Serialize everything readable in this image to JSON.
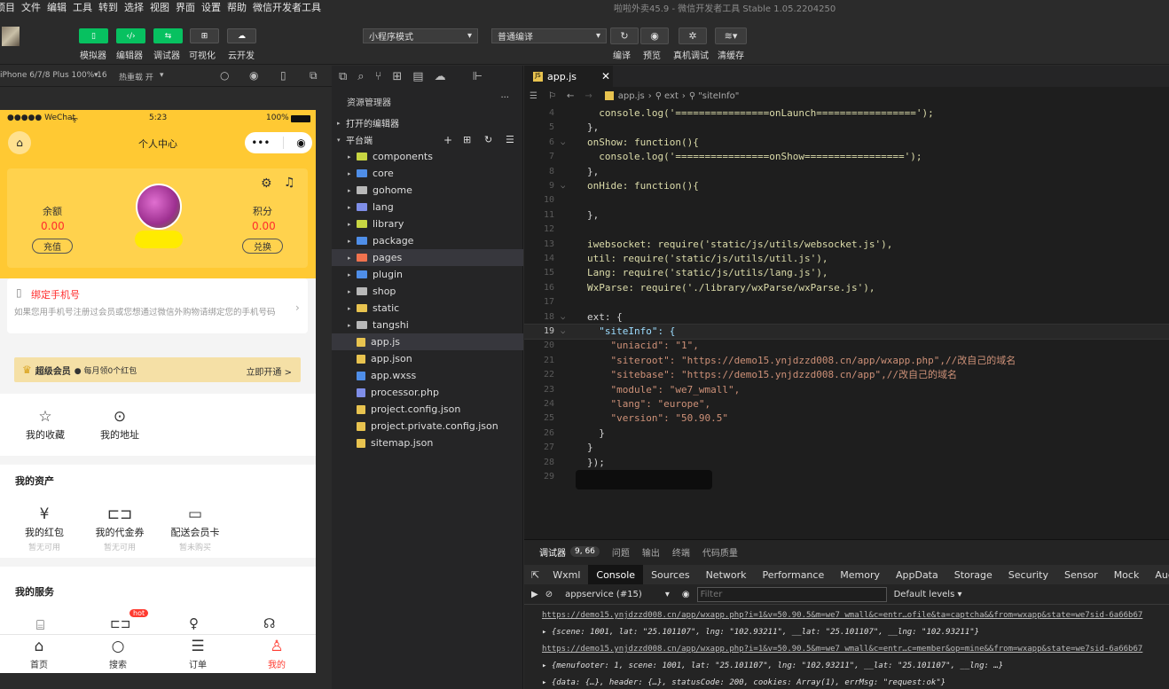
{
  "menu": [
    "项目",
    "文件",
    "编辑",
    "工具",
    "转到",
    "选择",
    "视图",
    "界面",
    "设置",
    "帮助",
    "微信开发者工具"
  ],
  "window_title": "啦啦外卖45.9 - 微信开发者工具 Stable 1.05.2204250",
  "toolbar": {
    "simulator": "模拟器",
    "editor": "编辑器",
    "debugger": "调试器",
    "visual": "可视化",
    "cloud": "云开发",
    "mode_select": "小程序模式",
    "compile_select": "普通编译",
    "compile": "编译",
    "preview": "预览",
    "real_debug": "真机调试",
    "clear_cache": "清缓存"
  },
  "simbar": {
    "device": "iPhone 6/7/8 Plus 100% 16",
    "hotreload": "热重载 开"
  },
  "phone": {
    "carrier": "●●●●● WeChat",
    "time": "5:23",
    "battery": "100%",
    "nav_title": "个人中心",
    "balance_label": "余额",
    "balance_value": "0.00",
    "recharge": "充值",
    "points_label": "积分",
    "points_value": "0.00",
    "exchange": "兑换",
    "bind_title": "绑定手机号",
    "bind_desc": "如果您用手机号注册过会员或您想通过微信外购物请绑定您的手机号码",
    "vip_title": "超级会员",
    "vip_desc": "● 每月领0个红包",
    "vip_action": "立即开通 >",
    "fav": "我的收藏",
    "address": "我的地址",
    "assets_title": "我的资产",
    "redpacket": "我的红包",
    "redpacket_sub": "暂无可用",
    "voucher": "我的代金券",
    "voucher_sub": "暂无可用",
    "delivery_card": "配送会员卡",
    "delivery_card_sub": "暂未购买",
    "services_title": "我的服务",
    "hot": "hot",
    "tabs": [
      "首页",
      "搜索",
      "订单",
      "我的"
    ]
  },
  "explorer": {
    "header": "资源管理器",
    "open_editors": "打开的编辑器",
    "workspace": "平台端",
    "items": [
      {
        "name": "components",
        "type": "folder",
        "color": "#c8d642"
      },
      {
        "name": "core",
        "type": "folder",
        "color": "#4f8ee8"
      },
      {
        "name": "gohome",
        "type": "folder",
        "color": "#b8b8b8"
      },
      {
        "name": "lang",
        "type": "folder",
        "color": "#7f8ee8"
      },
      {
        "name": "library",
        "type": "folder",
        "color": "#c8d642"
      },
      {
        "name": "package",
        "type": "folder",
        "color": "#4f8ee8"
      },
      {
        "name": "pages",
        "type": "folder",
        "color": "#f0724e"
      },
      {
        "name": "plugin",
        "type": "folder",
        "color": "#4f8ee8"
      },
      {
        "name": "shop",
        "type": "folder",
        "color": "#b8b8b8"
      },
      {
        "name": "static",
        "type": "folder",
        "color": "#e8c34f"
      },
      {
        "name": "tangshi",
        "type": "folder",
        "color": "#b8b8b8"
      },
      {
        "name": "app.js",
        "type": "file",
        "color": "#e8c34f"
      },
      {
        "name": "app.json",
        "type": "file",
        "color": "#e8c34f"
      },
      {
        "name": "app.wxss",
        "type": "file",
        "color": "#4f8ee8"
      },
      {
        "name": "processor.php",
        "type": "file",
        "color": "#7f8ee8"
      },
      {
        "name": "project.config.json",
        "type": "file",
        "color": "#e8c34f"
      },
      {
        "name": "project.private.config.json",
        "type": "file",
        "color": "#e8c34f"
      },
      {
        "name": "sitemap.json",
        "type": "file",
        "color": "#e8c34f"
      }
    ]
  },
  "editor": {
    "tab": "app.js",
    "breadcrumb_file": "app.js",
    "breadcrumb_ext": "ext",
    "breadcrumb_key": "\"siteInfo\"",
    "lines": [
      {
        "n": "4",
        "t": "  console.log('================onLaunch=================');"
      },
      {
        "n": "5",
        "t": "},"
      },
      {
        "n": "6",
        "t": "onShow: function(){"
      },
      {
        "n": "7",
        "t": "  console.log('================onShow=================');"
      },
      {
        "n": "8",
        "t": "},"
      },
      {
        "n": "9",
        "t": "onHide: function(){"
      },
      {
        "n": "10",
        "t": ""
      },
      {
        "n": "11",
        "t": "},"
      },
      {
        "n": "12",
        "t": ""
      },
      {
        "n": "13",
        "t": "iwebsocket: require('static/js/utils/websocket.js'),"
      },
      {
        "n": "14",
        "t": "util: require('static/js/utils/util.js'),"
      },
      {
        "n": "15",
        "t": "Lang: require('static/js/utils/lang.js'),"
      },
      {
        "n": "16",
        "t": "WxParse: require('./library/wxParse/wxParse.js'),"
      },
      {
        "n": "17",
        "t": ""
      },
      {
        "n": "18",
        "t": "ext: {"
      },
      {
        "n": "19",
        "t": "  \"siteInfo\": {"
      },
      {
        "n": "20",
        "t": "    \"uniacid\": \"1\","
      },
      {
        "n": "21",
        "t": "    \"siteroot\": \"https://demo15.ynjdzzd008.cn/app/wxapp.php\",//改自己的域名"
      },
      {
        "n": "22",
        "t": "    \"sitebase\": \"https://demo15.ynjdzzd008.cn/app\",//改自己的域名"
      },
      {
        "n": "23",
        "t": "    \"module\": \"we7_wmall\","
      },
      {
        "n": "24",
        "t": "    \"lang\": \"europe\","
      },
      {
        "n": "25",
        "t": "    \"version\": \"50.90.5\""
      },
      {
        "n": "26",
        "t": "  }"
      },
      {
        "n": "27",
        "t": "}"
      },
      {
        "n": "28",
        "t": "});"
      },
      {
        "n": "29",
        "t": ""
      }
    ]
  },
  "console": {
    "top_tabs": [
      "调试器",
      "9, 66",
      "问题",
      "输出",
      "终端",
      "代码质量"
    ],
    "tabs": [
      "Wxml",
      "Console",
      "Sources",
      "Network",
      "Performance",
      "Memory",
      "AppData",
      "Storage",
      "Security",
      "Sensor",
      "Mock",
      "Audits"
    ],
    "context": "appservice (#15)",
    "filter_placeholder": "Filter",
    "levels": "Default levels ▾",
    "logs": [
      "https://demo15.ynjdzzd008.cn/app/wxapp.php?i=1&v=50.90.5&m=we7_wmall&c=entr…ofile&ta=captcha&&from=wxapp&state=we7sid-6a66b67",
      "▸ {scene: 1001, lat: \"25.101107\", lng: \"102.93211\", __lat: \"25.101107\", __lng: \"102.93211\"}",
      "https://demo15.ynjdzzd008.cn/app/wxapp.php?i=1&v=50.90.5&m=we7_wmall&c=entr…c=member&op=mine&&from=wxapp&state=we7sid-6a66b67",
      "▸ {menufooter: 1, scene: 1001, lat: \"25.101107\", lng: \"102.93211\", __lat: \"25.101107\", __lng: …}",
      "▸ {data: {…}, header: {…}, statusCode: 200, cookies: Array(1), errMsg: \"request:ok\"}"
    ]
  },
  "colors": {
    "accent_green": "#07c160",
    "phone_yellow": "#ffc933",
    "price_red": "#ff2d2d"
  }
}
